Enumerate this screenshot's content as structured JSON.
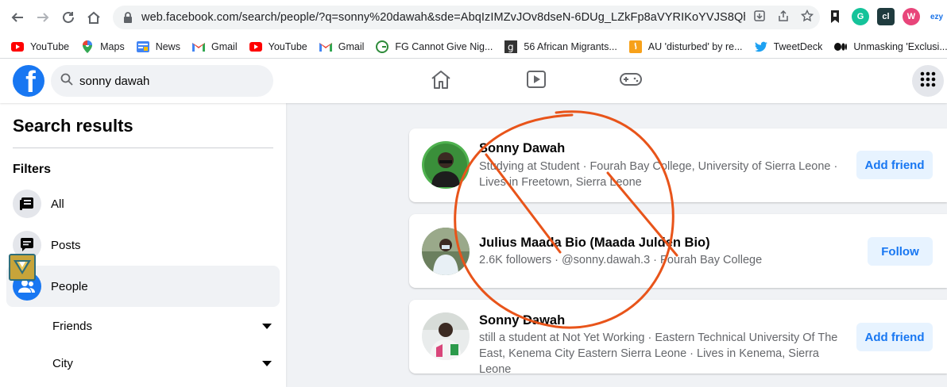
{
  "browser": {
    "url": "web.facebook.com/search/people/?q=sonny%20dawah&sde=AbqIzIMZvJOv8dseN-6DUg_LZkFp8aVYRIKoYVJS8Qh3ZWjc...",
    "extensions": [
      {
        "icon": "cap-icon",
        "color": "#222222",
        "text": ""
      },
      {
        "icon": "grammarly-icon",
        "color": "#15c39a",
        "text": "G"
      },
      {
        "icon": "cl-icon",
        "color": "#1f3b3e",
        "text": "cl"
      },
      {
        "icon": "w-icon",
        "color": "#e8457a",
        "text": "W"
      },
      {
        "icon": "ezy-icon",
        "color": "#ffffff",
        "text": "ezy"
      }
    ]
  },
  "bookmarks": [
    {
      "label": "YouTube",
      "icon": "youtube-icon"
    },
    {
      "label": "Maps",
      "icon": "maps-icon"
    },
    {
      "label": "News",
      "icon": "news-icon"
    },
    {
      "label": "Gmail",
      "icon": "gmail-icon"
    },
    {
      "label": "YouTube",
      "icon": "youtube-icon"
    },
    {
      "label": "Gmail",
      "icon": "gmail-icon"
    },
    {
      "label": "FG Cannot Give Nig...",
      "icon": "g-icon"
    },
    {
      "label": "56 African Migrants...",
      "icon": "g-dark-icon"
    },
    {
      "label": "AU 'disturbed' by re...",
      "icon": "aljazeera-icon"
    },
    {
      "label": "TweetDeck",
      "icon": "twitter-icon"
    },
    {
      "label": "Unmasking 'Exclusi...",
      "icon": "medium-icon"
    }
  ],
  "fb": {
    "logo": "f",
    "search_value": "sonny dawah"
  },
  "sidebar": {
    "title": "Search results",
    "filters_label": "Filters",
    "items": [
      {
        "label": "All",
        "icon": "feed-icon"
      },
      {
        "label": "Posts",
        "icon": "posts-icon"
      },
      {
        "label": "People",
        "icon": "people-icon"
      }
    ],
    "subfilters": [
      {
        "label": "Friends"
      },
      {
        "label": "City"
      }
    ]
  },
  "results": [
    {
      "name": "Sonny Dawah",
      "meta": "Studying at Student · Fourah Bay College, University of Sierra Leone · Lives in Freetown, Sierra Leone",
      "button": "Add friend"
    },
    {
      "name": "Julius Maada Bio (Maada Julden Bio)",
      "meta": "2.6K followers · @sonny.dawah.3 · Fourah Bay College",
      "button": "Follow"
    },
    {
      "name": "Sonny Dawah",
      "meta": "still a student at Not Yet Working · Eastern Technical University Of The East, Kenema City Eastern Sierra Leone · Lives in Kenema, Sierra Leone",
      "button": "Add friend"
    }
  ],
  "colors": {
    "fb_blue": "#1877f2",
    "annotation": "#e8541a"
  }
}
